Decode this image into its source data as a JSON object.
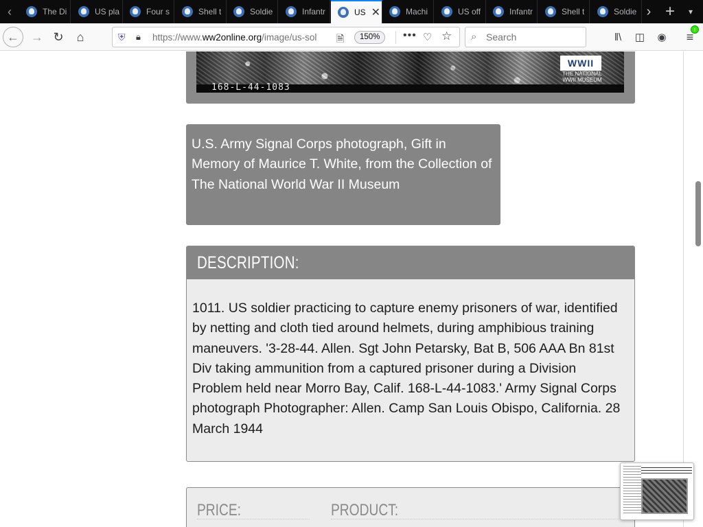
{
  "browser": {
    "tabs": [
      {
        "title": "The Di",
        "active": false
      },
      {
        "title": "US pla",
        "active": false
      },
      {
        "title": "Four s",
        "active": false
      },
      {
        "title": "Shell t",
        "active": false
      },
      {
        "title": "Soldie",
        "active": false
      },
      {
        "title": "Infantr",
        "active": false
      },
      {
        "title": "US",
        "active": true
      },
      {
        "title": "Machi",
        "active": false
      },
      {
        "title": "US off",
        "active": false
      },
      {
        "title": "Infantr",
        "active": false
      },
      {
        "title": "Shell t",
        "active": false
      },
      {
        "title": "Soldie",
        "active": false
      }
    ],
    "url": {
      "prefix": "https://www.",
      "host": "ww2online.org",
      "path": "/image/us-sol"
    },
    "zoom": "150%",
    "search_placeholder": "Search",
    "icons": {
      "tab_scroll_left": "chevron-left-icon",
      "tab_scroll_right": "chevron-right-icon",
      "new_tab": "plus-icon",
      "tab_list": "chevron-down-icon"
    }
  },
  "page": {
    "photo": {
      "film_code": "168-L-44-1083",
      "logo_text": "WWII",
      "logo_caption": "THE NATIONAL WWII MUSEUM"
    },
    "credit": "U.S. Army Signal Corps photograph, Gift in Memory of Maurice T. White, from the Collection of The National World War II Museum",
    "description": {
      "heading": "DESCRIPTION:",
      "body": "1011. US soldier practicing to capture enemy prisoners of war, identified by netting and cloth tied around helmets, during amphibious training maneuvers. '3-28-44. Allen. Sgt John Petarsky, Bat B, 506 AAA Bn 81st Div taking ammunition from a captured prisoner during a Division Problem held near Morro Bay, Calif. 168-L-44-1083.' Army Signal Corps photograph Photographer: Allen. Camp San Louis Obispo, California. 28 March 1944"
    },
    "price_heading": "PRICE:",
    "product_heading": "PRODUCT:"
  },
  "colors": {
    "active_tab_accent": "#0a84ff",
    "panel_gray": "#868686",
    "body_gray": "#ececec"
  }
}
